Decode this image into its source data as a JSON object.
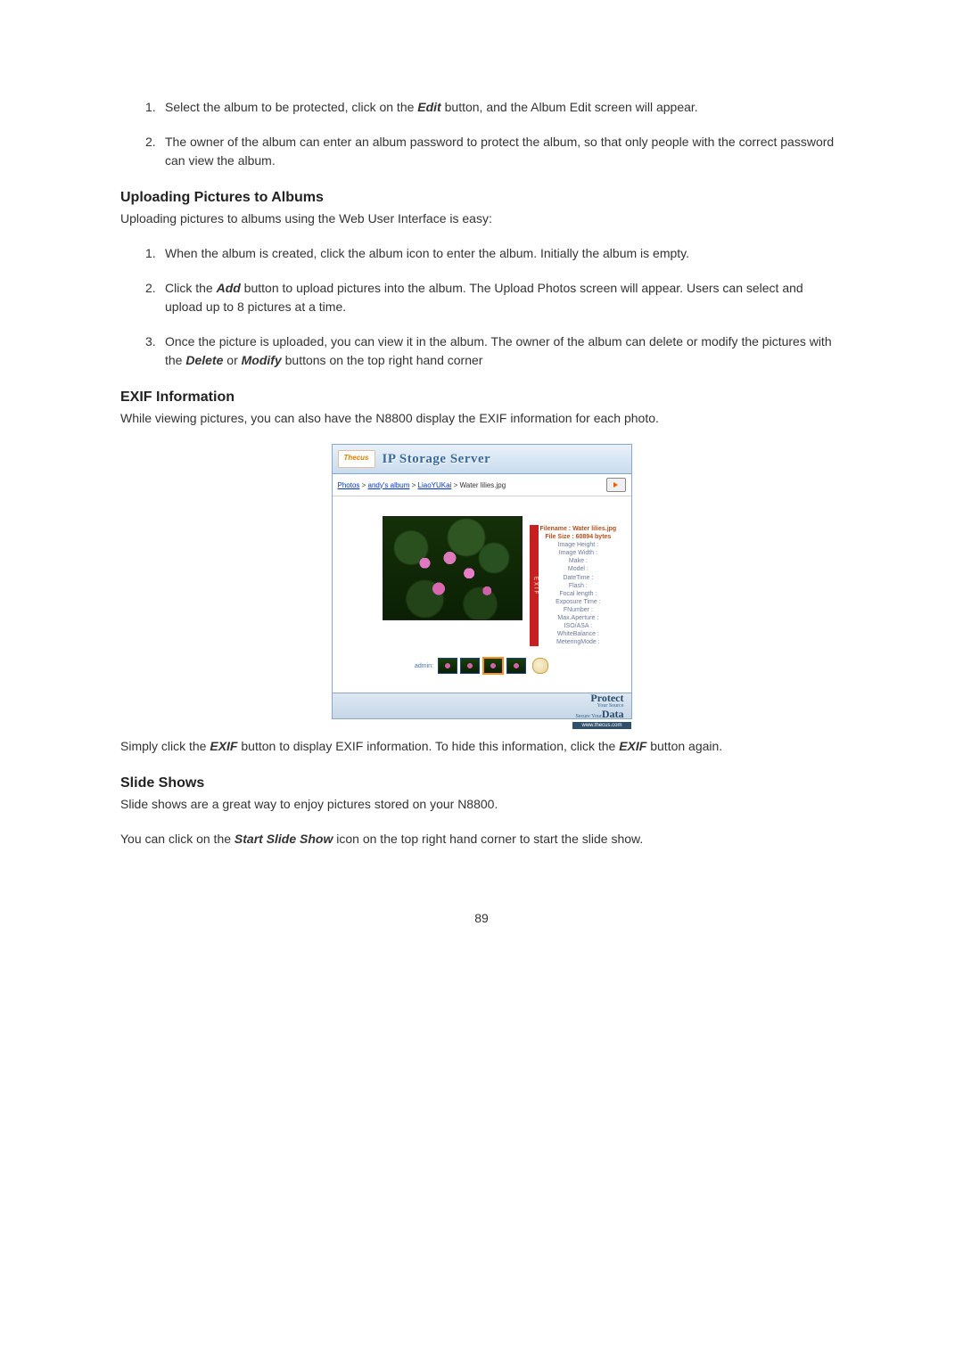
{
  "intro_list": [
    {
      "num": "1.",
      "text_pre": "Select the album to be protected, click on the ",
      "em": "Edit",
      "text_post": " button, and the Album Edit screen will appear."
    },
    {
      "num": "2.",
      "text_pre": "The owner of the album can enter an album password to protect the album, so that only people with the correct password can view the album.",
      "em": "",
      "text_post": ""
    }
  ],
  "upload": {
    "heading": "Uploading Pictures to Albums",
    "intro": "Uploading pictures to albums using the Web User Interface is easy:",
    "items": [
      {
        "num": "1.",
        "full": "When the album is created, click the album icon to enter the album. Initially the album is empty."
      },
      {
        "num": "2.",
        "pre": "Click the ",
        "em": "Add",
        "post": " button to upload pictures into the album. The Upload Photos screen will appear. Users can select and upload up to 8 pictures at a time."
      },
      {
        "num": "3.",
        "pre": "Once the picture is uploaded, you can view it in the album. The owner of the album can delete or modify the pictures with the ",
        "em1": "Delete",
        "mid": " or ",
        "em2": "Modify",
        "post": " buttons on the top right hand corner"
      }
    ]
  },
  "exif": {
    "heading": "EXIF Information",
    "intro": "While viewing pictures, you can also have the N8800 display the EXIF information for each photo.",
    "after_pre": "Simply click the ",
    "after_em1": "EXIF",
    "after_mid": " button to display EXIF information. To hide this information, click the ",
    "after_em2": "EXIF",
    "after_post": " button again."
  },
  "slideshow": {
    "heading": "Slide Shows",
    "intro": "Slide shows are a great way to enjoy pictures stored on your N8800.",
    "body_pre": "You can click on the ",
    "body_em": "Start Slide Show",
    "body_post": " icon on the top right hand corner to start the slide show."
  },
  "screenshot": {
    "logo": "Thecus",
    "title": "IP Storage Server",
    "bc1": "Photos",
    "bcsep": " > ",
    "bc2": "andy's album",
    "bc3": "LiaoYUKai",
    "bc4": "Water lilies.jpg",
    "exif_flag": "EXIF",
    "exif_lines": [
      "Filename : Water lilies.jpg",
      "File Size : 60894 bytes",
      "Image Height :",
      "Image Width :",
      "Make :",
      "Model :",
      "DateTime :",
      "Flash :",
      "Focal length :",
      "Exposure Time :",
      "FNumber :",
      "Max.Aperture :",
      "ISO/ASA :",
      "WhiteBalance :",
      "MeteringMode :"
    ],
    "thumb_label": "admin:",
    "protect": "Protect",
    "your_source": "Your Source",
    "secure_your": "Secure Your",
    "data": "Data",
    "url": "www.thecus.com"
  },
  "page_number": "89"
}
